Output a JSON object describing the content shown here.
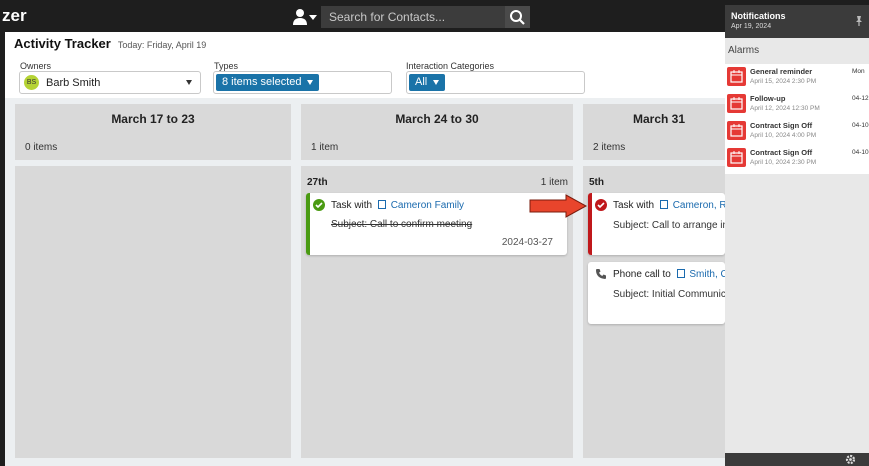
{
  "app": {
    "logo_text": "zer"
  },
  "topbar": {
    "search_placeholder": "Search for Contacts...",
    "user_icon": "user-icon",
    "search_icon": "search-icon"
  },
  "header": {
    "title": "Activity Tracker",
    "today": "Today: Friday, April 19"
  },
  "filters": {
    "owners_label": "Owners",
    "owner_initials": "BS",
    "owner_name": "Barb Smith",
    "types_label": "Types",
    "types_value": "8 items selected",
    "categories_label": "Interaction Categories",
    "categories_value": "All"
  },
  "columns": [
    {
      "title": "March 17 to 23",
      "count": "0 items"
    },
    {
      "title": "March 24 to 30",
      "count": "1 item",
      "day": {
        "label": "27th",
        "count": "1 item"
      },
      "cards": [
        {
          "type_icon": "check-circle-icon",
          "prefix": "Task with",
          "contact": "Cameron Family",
          "subject": "Subject: Call to confirm meeting",
          "date": "2024-03-27",
          "bar_color": "#4a9a12"
        }
      ]
    },
    {
      "title": "March 31",
      "count": "2 items",
      "day": {
        "label": "5th"
      },
      "cards": [
        {
          "type_icon": "check-circle-icon",
          "prefix": "Task with",
          "contact": "Cameron, Rob",
          "subject": "Subject: Call to arrange in p",
          "bar_color": "#c0181b"
        },
        {
          "type_icon": "phone-icon",
          "prefix": "Phone call to",
          "contact": "Smith, Cel",
          "subject": "Subject: Initial Communica"
        }
      ]
    }
  ],
  "notifications": {
    "title": "Notifications",
    "date": "Apr 19, 2024",
    "alarms_label": "Alarms",
    "alarms": [
      {
        "name": "General reminder",
        "date": "April 15, 2024 2:30 PM",
        "side": "Mon"
      },
      {
        "name": "Follow-up",
        "date": "April 12, 2024 12:30 PM",
        "side": "04-12"
      },
      {
        "name": "Contract Sign Off",
        "date": "April 10, 2024 4:00 PM",
        "side": "04-10"
      },
      {
        "name": "Contract Sign Off",
        "date": "April 10, 2024 2:30 PM",
        "side": "04-10"
      }
    ]
  },
  "colors": {
    "accent": "#1a73a8",
    "alarm": "#e53935",
    "done": "#4a9a12",
    "overdue": "#c0181b",
    "arrow": "#e8452c"
  }
}
